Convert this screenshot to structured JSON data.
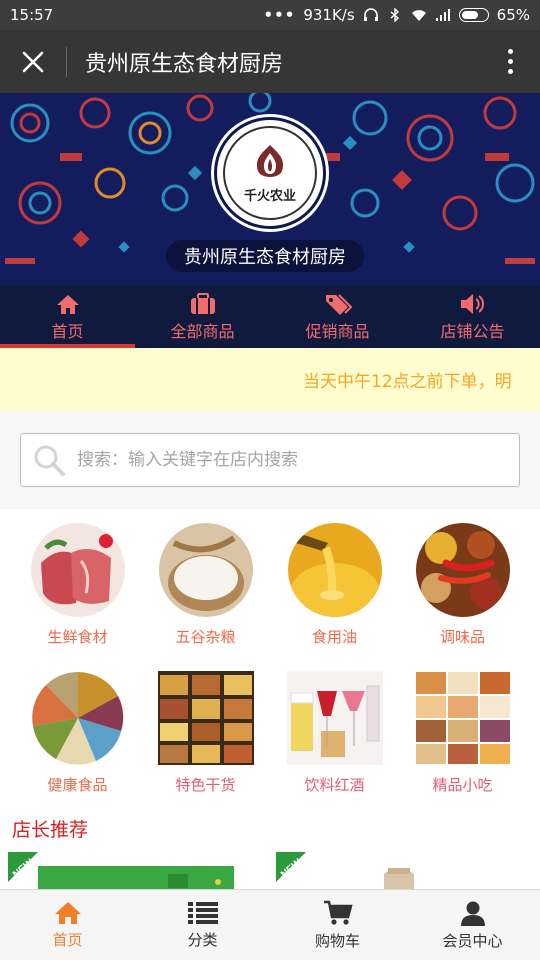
{
  "status_bar": {
    "time": "15:57",
    "dots": "•••",
    "network_speed": "931K/s",
    "battery_percent": "65%",
    "battery_level": 0.65
  },
  "title_bar": {
    "title": "贵州原生态食材厨房"
  },
  "banner": {
    "logo_text": "千火农业",
    "store_name": "贵州原生态食材厨房"
  },
  "nav_tabs": [
    {
      "label": "首页",
      "icon": "home-icon",
      "active": true
    },
    {
      "label": "全部商品",
      "icon": "briefcase-icon",
      "active": false
    },
    {
      "label": "促销商品",
      "icon": "tags-icon",
      "active": false
    },
    {
      "label": "店铺公告",
      "icon": "volume-icon",
      "active": false
    }
  ],
  "notice": {
    "text": "当天中午12点之前下单，明"
  },
  "search": {
    "placeholder": "搜索：输入关键字在店内搜索"
  },
  "categories": [
    {
      "label": "生鲜食材",
      "icon": "fresh-meat-image"
    },
    {
      "label": "五谷杂粮",
      "icon": "rice-image"
    },
    {
      "label": "食用油",
      "icon": "cooking-oil-image"
    },
    {
      "label": "调味品",
      "icon": "spices-image"
    },
    {
      "label": "健康食品",
      "icon": "healthy-food-image"
    },
    {
      "label": "特色干货",
      "icon": "dried-goods-image"
    },
    {
      "label": "饮料红酒",
      "icon": "drinks-wine-image"
    },
    {
      "label": "精品小吃",
      "icon": "snacks-image"
    }
  ],
  "recommend": {
    "title": "店长推荐",
    "badge": "NEW"
  },
  "bottom_bar": [
    {
      "label": "首页",
      "icon": "home-icon",
      "active": true
    },
    {
      "label": "分类",
      "icon": "list-icon",
      "active": false
    },
    {
      "label": "购物车",
      "icon": "cart-icon",
      "active": false
    },
    {
      "label": "会员中心",
      "icon": "user-icon",
      "active": false
    }
  ],
  "colors": {
    "accent_orange": "#f07e2a",
    "nav_red": "#f06d6d",
    "banner_navy": "#131d5e",
    "notice_yellow": "#f5a623",
    "recommend_red": "#e02020"
  }
}
